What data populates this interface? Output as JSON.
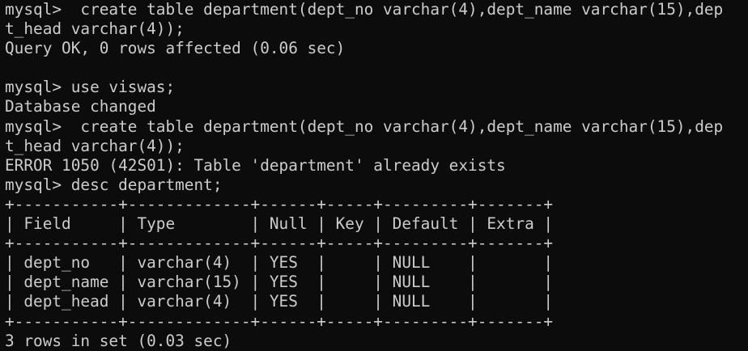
{
  "terminal": {
    "lines": [
      "mysql>  create table department(dept_no varchar(4),dept_name varchar(15),dep",
      "t_head varchar(4));",
      "Query OK, 0 rows affected (0.06 sec)",
      "",
      "mysql> use viswas;",
      "Database changed",
      "mysql>  create table department(dept_no varchar(4),dept_name varchar(15),dep",
      "t_head varchar(4));",
      "ERROR 1050 (42S01): Table 'department' already exists",
      "mysql> desc department;",
      "+-----------+-------------+------+-----+---------+-------+",
      "| Field     | Type        | Null | Key | Default | Extra |",
      "+-----------+-------------+------+-----+---------+-------+",
      "| dept_no   | varchar(4)  | YES  |     | NULL    |       |",
      "| dept_name | varchar(15) | YES  |     | NULL    |       |",
      "| dept_head | varchar(4)  | YES  |     | NULL    |       |",
      "+-----------+-------------+------+-----+---------+-------+",
      "3 rows in set (0.03 sec)"
    ]
  },
  "colors": {
    "background": "#0c0c0c",
    "foreground": "#cccccc"
  }
}
